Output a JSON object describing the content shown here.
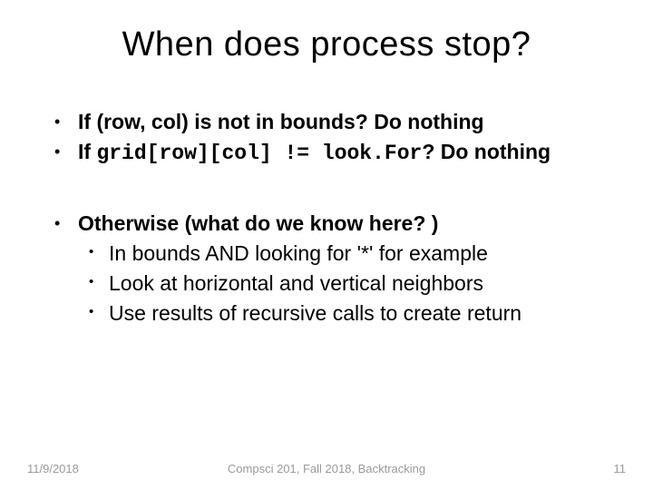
{
  "title": "When does process stop?",
  "bullets": {
    "b1_pre": "If (row, col) is not in bounds? Do nothing",
    "b2_pre": "If ",
    "b2_code": "grid[row][col] != look.For",
    "b2_post": "? Do nothing",
    "b3": "Otherwise (what do we know here? )",
    "s1": "In bounds AND looking for '*' for example",
    "s2": "Look at horizontal and vertical neighbors",
    "s3": "Use results of recursive calls to create return"
  },
  "footer": {
    "date": "11/9/2018",
    "center": "Compsci 201, Fall 2018,  Backtracking",
    "page": "11"
  }
}
